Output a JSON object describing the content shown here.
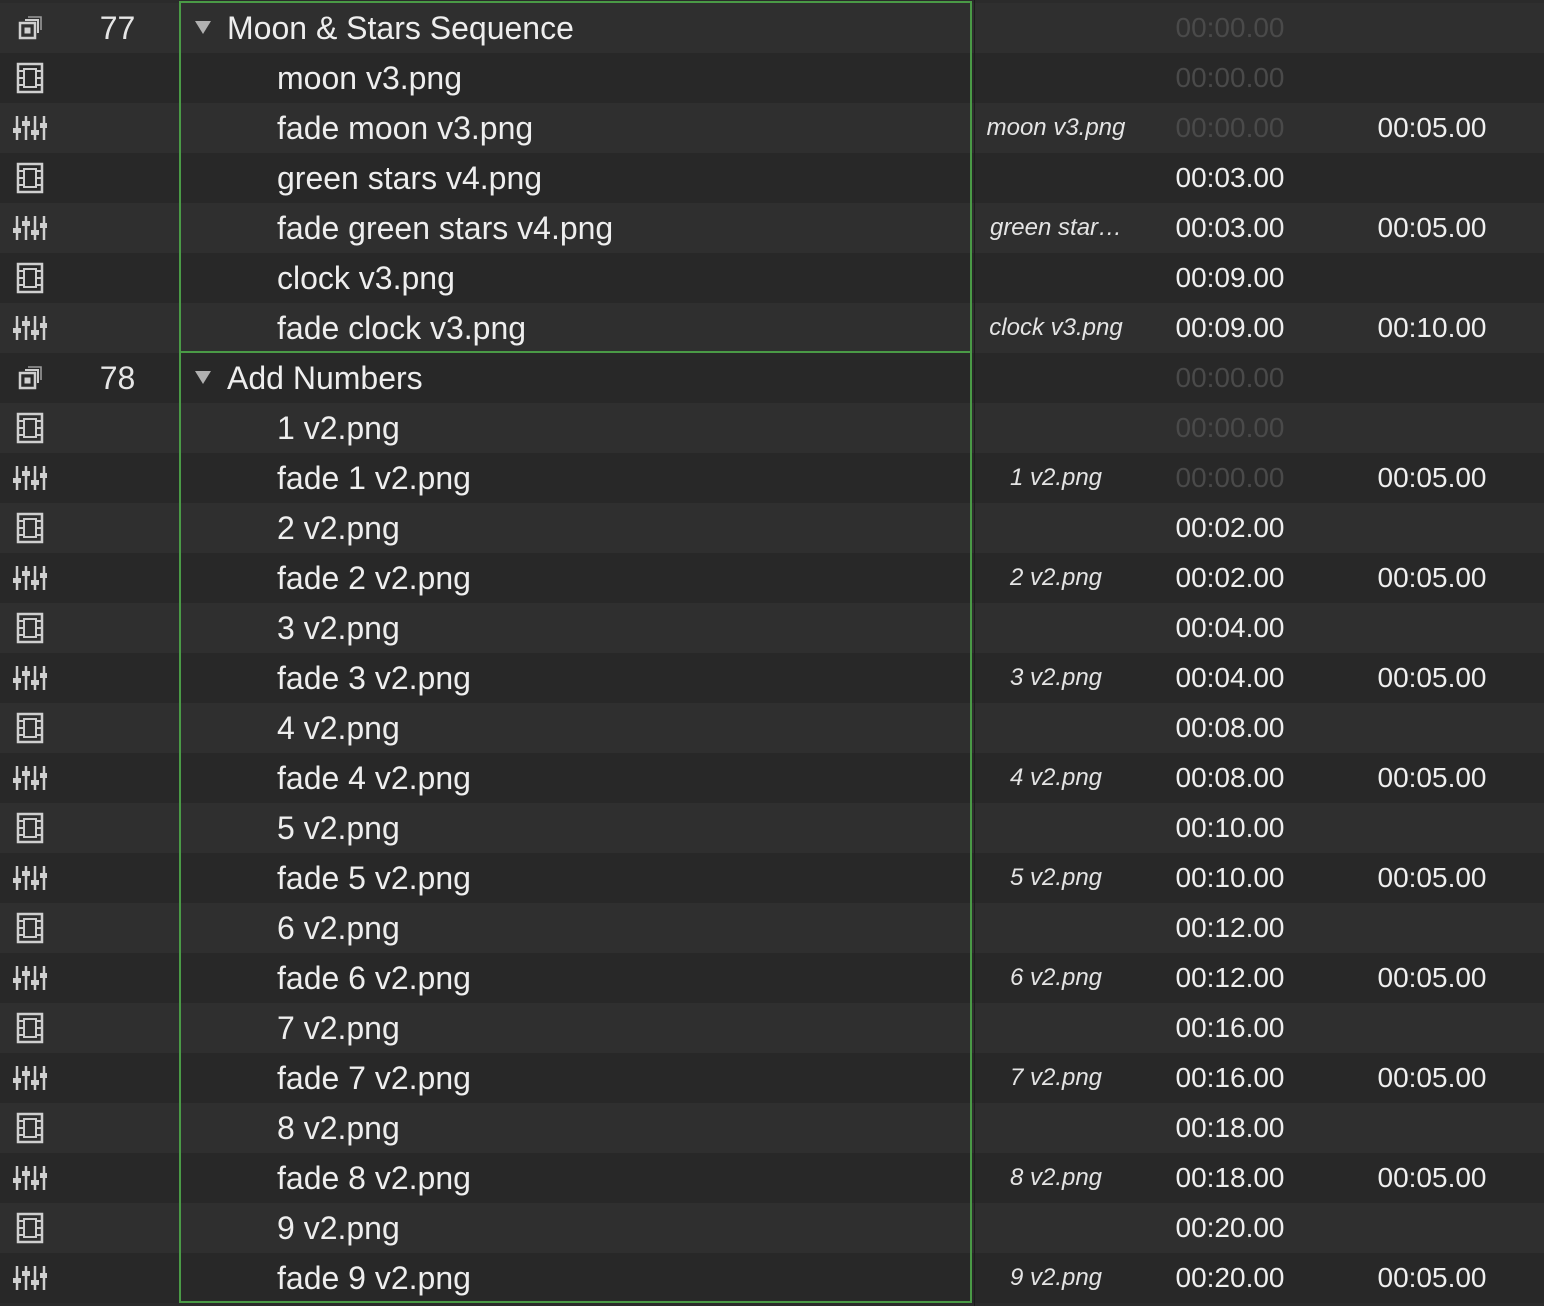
{
  "accent_color": "#4a9a46",
  "rows": [
    {
      "kind": "group",
      "icon": "group-icon",
      "number": "77",
      "name": "Moon & Stars Sequence",
      "target": "",
      "wait": "00:00.00",
      "wait_dim": true,
      "duration": ""
    },
    {
      "kind": "video",
      "icon": "film-icon",
      "number": "",
      "name": "moon v3.png",
      "target": "",
      "wait": "00:00.00",
      "wait_dim": true,
      "duration": ""
    },
    {
      "kind": "fade",
      "icon": "fade-icon",
      "number": "",
      "name": "fade moon v3.png",
      "target": "moon v3.png",
      "wait": "00:00.00",
      "wait_dim": true,
      "duration": "00:05.00"
    },
    {
      "kind": "video",
      "icon": "film-icon",
      "number": "",
      "name": "green stars v4.png",
      "target": "",
      "wait": "00:03.00",
      "wait_dim": false,
      "duration": ""
    },
    {
      "kind": "fade",
      "icon": "fade-icon",
      "number": "",
      "name": "fade green stars v4.png",
      "target": "green star…",
      "wait": "00:03.00",
      "wait_dim": false,
      "duration": "00:05.00"
    },
    {
      "kind": "video",
      "icon": "film-icon",
      "number": "",
      "name": "clock v3.png",
      "target": "",
      "wait": "00:09.00",
      "wait_dim": false,
      "duration": ""
    },
    {
      "kind": "fade",
      "icon": "fade-icon",
      "number": "",
      "name": "fade clock v3.png",
      "target": "clock v3.png",
      "wait": "00:09.00",
      "wait_dim": false,
      "duration": "00:10.00"
    },
    {
      "kind": "group",
      "icon": "group-icon",
      "number": "78",
      "name": "Add Numbers",
      "target": "",
      "wait": "00:00.00",
      "wait_dim": true,
      "duration": ""
    },
    {
      "kind": "video",
      "icon": "film-icon",
      "number": "",
      "name": "1 v2.png",
      "target": "",
      "wait": "00:00.00",
      "wait_dim": true,
      "duration": ""
    },
    {
      "kind": "fade",
      "icon": "fade-icon",
      "number": "",
      "name": "fade 1 v2.png",
      "target": "1 v2.png",
      "wait": "00:00.00",
      "wait_dim": true,
      "duration": "00:05.00"
    },
    {
      "kind": "video",
      "icon": "film-icon",
      "number": "",
      "name": "2 v2.png",
      "target": "",
      "wait": "00:02.00",
      "wait_dim": false,
      "duration": ""
    },
    {
      "kind": "fade",
      "icon": "fade-icon",
      "number": "",
      "name": "fade 2 v2.png",
      "target": "2 v2.png",
      "wait": "00:02.00",
      "wait_dim": false,
      "duration": "00:05.00"
    },
    {
      "kind": "video",
      "icon": "film-icon",
      "number": "",
      "name": "3 v2.png",
      "target": "",
      "wait": "00:04.00",
      "wait_dim": false,
      "duration": ""
    },
    {
      "kind": "fade",
      "icon": "fade-icon",
      "number": "",
      "name": "fade 3 v2.png",
      "target": "3 v2.png",
      "wait": "00:04.00",
      "wait_dim": false,
      "duration": "00:05.00"
    },
    {
      "kind": "video",
      "icon": "film-icon",
      "number": "",
      "name": "4 v2.png",
      "target": "",
      "wait": "00:08.00",
      "wait_dim": false,
      "duration": ""
    },
    {
      "kind": "fade",
      "icon": "fade-icon",
      "number": "",
      "name": "fade 4 v2.png",
      "target": "4 v2.png",
      "wait": "00:08.00",
      "wait_dim": false,
      "duration": "00:05.00"
    },
    {
      "kind": "video",
      "icon": "film-icon",
      "number": "",
      "name": "5 v2.png",
      "target": "",
      "wait": "00:10.00",
      "wait_dim": false,
      "duration": ""
    },
    {
      "kind": "fade",
      "icon": "fade-icon",
      "number": "",
      "name": "fade 5 v2.png",
      "target": "5 v2.png",
      "wait": "00:10.00",
      "wait_dim": false,
      "duration": "00:05.00"
    },
    {
      "kind": "video",
      "icon": "film-icon",
      "number": "",
      "name": "6 v2.png",
      "target": "",
      "wait": "00:12.00",
      "wait_dim": false,
      "duration": ""
    },
    {
      "kind": "fade",
      "icon": "fade-icon",
      "number": "",
      "name": "fade 6 v2.png",
      "target": "6 v2.png",
      "wait": "00:12.00",
      "wait_dim": false,
      "duration": "00:05.00"
    },
    {
      "kind": "video",
      "icon": "film-icon",
      "number": "",
      "name": "7 v2.png",
      "target": "",
      "wait": "00:16.00",
      "wait_dim": false,
      "duration": ""
    },
    {
      "kind": "fade",
      "icon": "fade-icon",
      "number": "",
      "name": "fade 7 v2.png",
      "target": "7 v2.png",
      "wait": "00:16.00",
      "wait_dim": false,
      "duration": "00:05.00"
    },
    {
      "kind": "video",
      "icon": "film-icon",
      "number": "",
      "name": "8 v2.png",
      "target": "",
      "wait": "00:18.00",
      "wait_dim": false,
      "duration": ""
    },
    {
      "kind": "fade",
      "icon": "fade-icon",
      "number": "",
      "name": "fade 8 v2.png",
      "target": "8 v2.png",
      "wait": "00:18.00",
      "wait_dim": false,
      "duration": "00:05.00"
    },
    {
      "kind": "video",
      "icon": "film-icon",
      "number": "",
      "name": "9 v2.png",
      "target": "",
      "wait": "00:20.00",
      "wait_dim": false,
      "duration": ""
    },
    {
      "kind": "fade",
      "icon": "fade-icon",
      "number": "",
      "name": "fade 9 v2.png",
      "target": "9 v2.png",
      "wait": "00:20.00",
      "wait_dim": false,
      "duration": "00:05.00"
    }
  ]
}
